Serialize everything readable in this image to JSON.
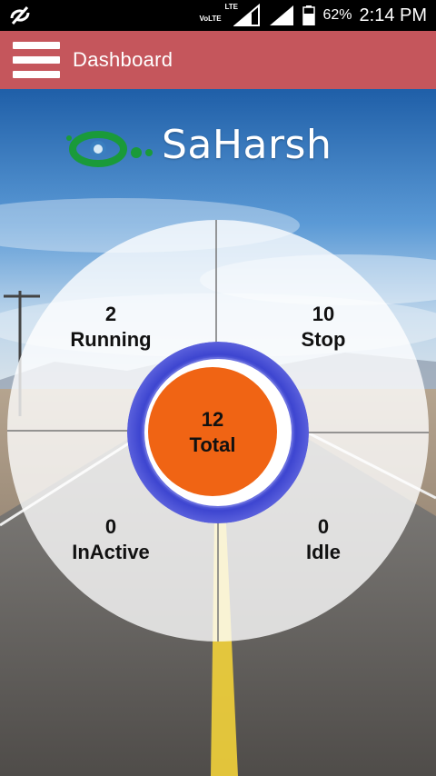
{
  "status_bar": {
    "lte": "LTE",
    "volte": "VoLTE",
    "battery": "62%",
    "time": "2:14 PM"
  },
  "app_bar": {
    "title": "Dashboard"
  },
  "logo": {
    "text": "SaHarsh"
  },
  "dashboard": {
    "running": {
      "count": "2",
      "label": "Running"
    },
    "stop": {
      "count": "10",
      "label": "Stop"
    },
    "inactive": {
      "count": "0",
      "label": "InActive"
    },
    "idle": {
      "count": "0",
      "label": "Idle"
    },
    "total": {
      "count": "12",
      "label": "Total"
    }
  },
  "colors": {
    "app_bar": "#c5565c",
    "total_circle": "#f06414",
    "ring": "#4a4fd0",
    "logo_green": "#1a9a3a"
  }
}
